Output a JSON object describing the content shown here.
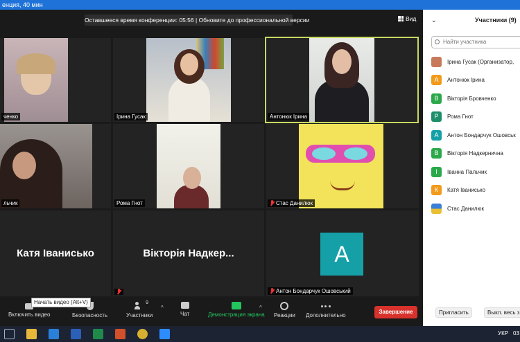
{
  "window": {
    "title": "енция, 40 мин"
  },
  "banner": {
    "text": "Оставшееся время конференции: 05:56 | Обновите до профессиональной версии"
  },
  "view_button": {
    "label": "Вид"
  },
  "tiles": [
    {
      "name": "ченко",
      "muted": false
    },
    {
      "name": "Ірина Гусак",
      "muted": false
    },
    {
      "name": "Антонюк Ірина",
      "muted": false,
      "active": true
    },
    {
      "name": "льчик",
      "muted": false
    },
    {
      "name": "Рома Гнот",
      "muted": false
    },
    {
      "name": "Стас Данилюк",
      "muted": true
    },
    {
      "name": "Катя Іванисько",
      "muted": false
    },
    {
      "name": "Вікторія Надкер...",
      "muted": true
    },
    {
      "name": "Антон Бондарчук Ошовський",
      "muted": true,
      "avatar": "A"
    }
  ],
  "toolbar": {
    "video_label": "Включить видео",
    "security_label": "Безопасность",
    "participants_label": "Участники",
    "participants_count": "9",
    "chat_label": "Чат",
    "share_label": "Демонстрация экрана",
    "reactions_label": "Реакции",
    "more_label": "Дополнительно",
    "end_label": "Завершение",
    "tooltip": "Начать видео (Alt+V)",
    "caret": "^"
  },
  "panel": {
    "title": "Участники (9)",
    "chevron": "⌄",
    "search_placeholder": "Найти участника",
    "participants": [
      {
        "name": "Ірина Гусак (Организатор,",
        "initial": "",
        "color": "#c77a5a"
      },
      {
        "name": "Антонюк Ірина",
        "initial": "А",
        "color": "#f29a1a"
      },
      {
        "name": "Вікторія Бровченко",
        "initial": "В",
        "color": "#2aa84a"
      },
      {
        "name": "Рома Гнот",
        "initial": "Р",
        "color": "#1c8f6a"
      },
      {
        "name": "Антон Бондарчук Ошовськ",
        "initial": "А",
        "color": "#15a0a8"
      },
      {
        "name": "Вікторія Надкернична",
        "initial": "В",
        "color": "#2aa84a"
      },
      {
        "name": "Іванна Пальчик",
        "initial": "І",
        "color": "#2aa84a"
      },
      {
        "name": "Катя Іванисько",
        "initial": "К",
        "color": "#f29a1a"
      },
      {
        "name": "Стас Данилюк",
        "initial": "",
        "color": "#e8c032"
      }
    ],
    "invite_label": "Пригласить",
    "mute_all_label": "Выкл. весь зв"
  },
  "taskbar": {
    "lang": "УКР",
    "time": "03"
  }
}
